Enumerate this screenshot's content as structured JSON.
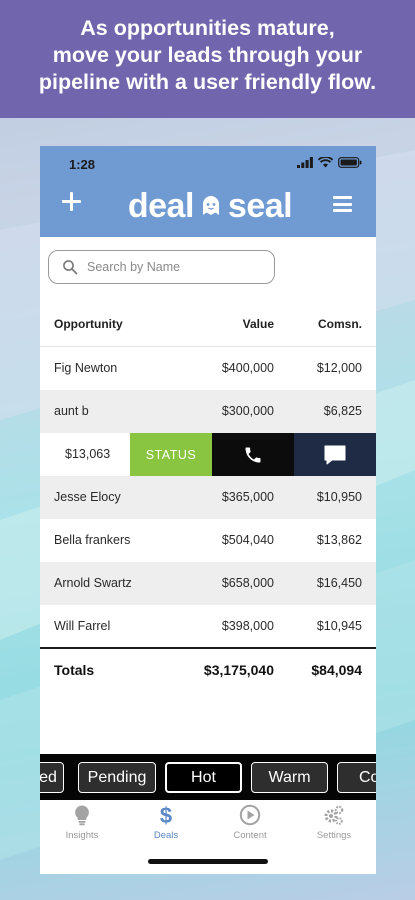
{
  "headline": {
    "lines": [
      "As opportunities mature,",
      "move your leads through your",
      "pipeline with a user friendly flow."
    ]
  },
  "status_bar": {
    "time": "1:28"
  },
  "app": {
    "brand_left": "deal",
    "brand_right": "seal"
  },
  "search": {
    "placeholder": "Search by Name"
  },
  "table": {
    "headers": {
      "opportunity": "Opportunity",
      "value": "Value",
      "commission": "Comsn."
    },
    "rows": [
      {
        "opportunity": "Fig Newton",
        "value": "$400,000",
        "commission": "$12,000"
      },
      {
        "opportunity": "aunt b",
        "value": "$300,000",
        "commission": "$6,825"
      },
      {
        "opportunity": "Jesse Elocy",
        "value": "$365,000",
        "commission": "$10,950"
      },
      {
        "opportunity": "Bella frankers",
        "value": "$504,040",
        "commission": "$13,862"
      },
      {
        "opportunity": "Arnold Swartz",
        "value": "$658,000",
        "commission": "$16,450"
      },
      {
        "opportunity": "Will Farrel",
        "value": "$398,000",
        "commission": "$10,945"
      }
    ],
    "swiped_row": {
      "value": "$13,063",
      "status_label": "STATUS"
    },
    "totals": {
      "label": "Totals",
      "value": "$3,175,040",
      "commission": "$84,094"
    }
  },
  "filters": {
    "chips": [
      "ed",
      "Pending",
      "Hot",
      "Warm",
      "Co"
    ],
    "selected": "Hot"
  },
  "tabs": [
    {
      "label": "Insights",
      "icon": "lightbulb-icon"
    },
    {
      "label": "Deals",
      "icon": "dollar-icon"
    },
    {
      "label": "Content",
      "icon": "play-circle-icon"
    },
    {
      "label": "Settings",
      "icon": "gears-icon"
    }
  ],
  "active_tab": "Deals",
  "colors": {
    "headline_bg": "#7165ad",
    "appbar_bg": "#6f9ad2",
    "status_green": "#89c540",
    "message_navy": "#1f2b44",
    "active_tab": "#5a87c6"
  }
}
